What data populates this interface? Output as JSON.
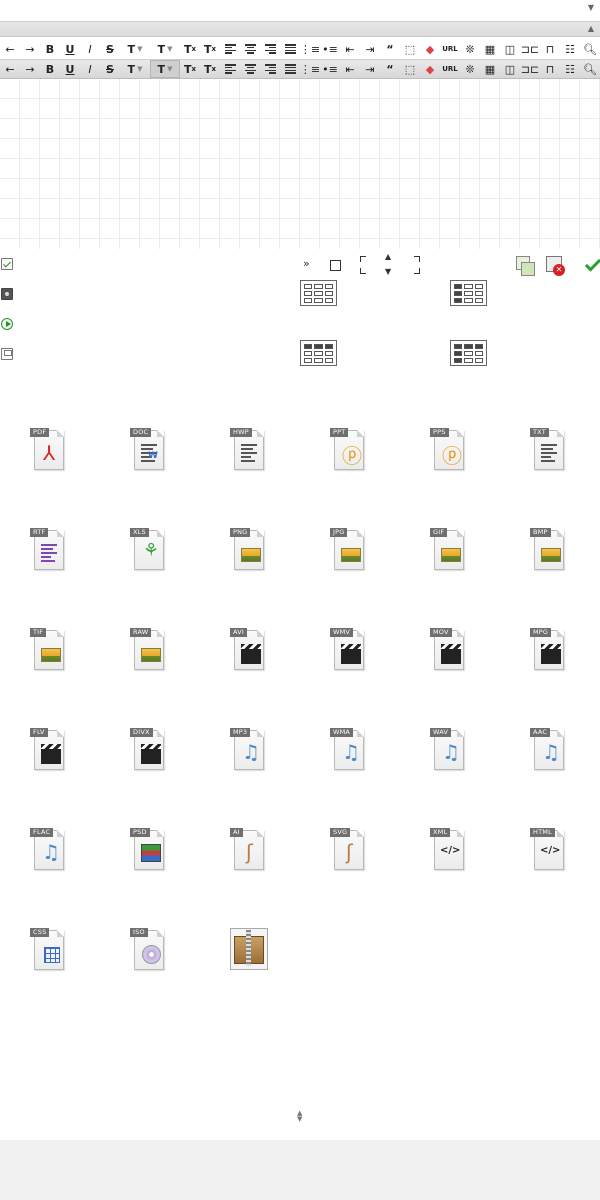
{
  "toolbar": {
    "url_label": "URL"
  },
  "layout_arrows": {
    "expand": "»"
  },
  "files": [
    {
      "label": "PDF",
      "glyph": "pdf"
    },
    {
      "label": "DOC",
      "glyph": "doc"
    },
    {
      "label": "HWP",
      "glyph": "text"
    },
    {
      "label": "PPT",
      "glyph": "ppt"
    },
    {
      "label": "PPS",
      "glyph": "ppt"
    },
    {
      "label": "TXT",
      "glyph": "text"
    },
    {
      "label": "RTF",
      "glyph": "rtf"
    },
    {
      "label": "XLS",
      "glyph": "xls"
    },
    {
      "label": "PNG",
      "glyph": "img"
    },
    {
      "label": "JPG",
      "glyph": "img"
    },
    {
      "label": "GIF",
      "glyph": "img"
    },
    {
      "label": "BMP",
      "glyph": "img"
    },
    {
      "label": "TIF",
      "glyph": "img"
    },
    {
      "label": "RAW",
      "glyph": "img"
    },
    {
      "label": "AVI",
      "glyph": "clap"
    },
    {
      "label": "WMV",
      "glyph": "clap"
    },
    {
      "label": "MOV",
      "glyph": "clap"
    },
    {
      "label": "MPG",
      "glyph": "clap"
    },
    {
      "label": "FLV",
      "glyph": "clap"
    },
    {
      "label": "DIVX",
      "glyph": "clap"
    },
    {
      "label": "MP3",
      "glyph": "note"
    },
    {
      "label": "WMA",
      "glyph": "note"
    },
    {
      "label": "WAV",
      "glyph": "note"
    },
    {
      "label": "AAC",
      "glyph": "note"
    },
    {
      "label": "FLAC",
      "glyph": "note"
    },
    {
      "label": "PSD",
      "glyph": "psd"
    },
    {
      "label": "AI",
      "glyph": "vec"
    },
    {
      "label": "SVG",
      "glyph": "vec"
    },
    {
      "label": "XML",
      "glyph": "code"
    },
    {
      "label": "HTML",
      "glyph": "code"
    },
    {
      "label": "CSS",
      "glyph": "css"
    },
    {
      "label": "ISO",
      "glyph": "iso"
    }
  ],
  "colors": {
    "accept": "#2aa22a",
    "delete": "#d82020",
    "grid": "#ececec"
  }
}
